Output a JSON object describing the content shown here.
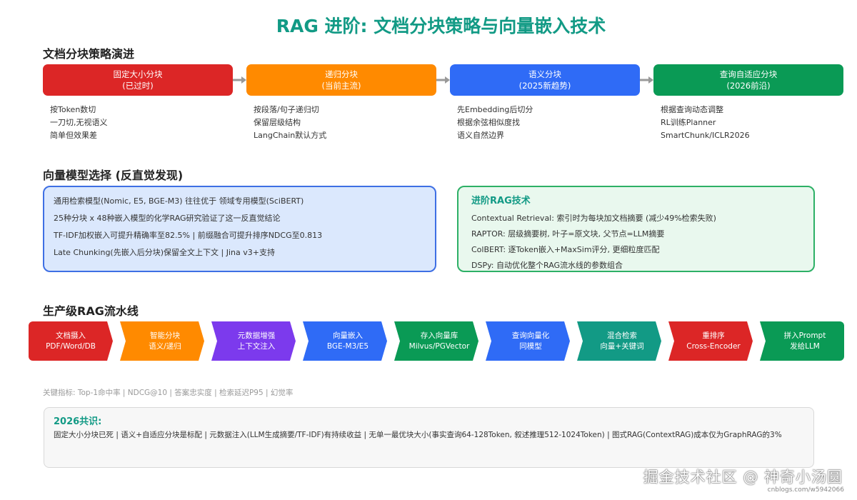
{
  "title": "RAG 进阶: 文档分块策略与向量嵌入技术",
  "section1": {
    "heading": "文档分块策略演进",
    "stages": [
      {
        "name": "固定大小分块",
        "sub": "(已过时)",
        "color": "#dc2626",
        "items": [
          "按Token数切",
          "一刀切,无视语义",
          "简单但效果差"
        ]
      },
      {
        "name": "递归分块",
        "sub": "(当前主流)",
        "color": "#ff8a00",
        "items": [
          "按段落/句子递归切",
          "保留层级结构",
          "LangChain默认方式"
        ]
      },
      {
        "name": "语义分块",
        "sub": "(2025新趋势)",
        "color": "#2f6bf6",
        "items": [
          "先Embedding后切分",
          "根据余弦相似度找",
          "语义自然边界"
        ]
      },
      {
        "name": "查询自适应分块",
        "sub": "(2026前沿)",
        "color": "#0a9a55",
        "items": [
          "根据查询动态调整",
          "RL训练Planner",
          "SmartChunk/ICLR2026"
        ]
      }
    ],
    "arrow_color": "#999999"
  },
  "section2": {
    "heading": "向量模型选择 (反直觉发现)",
    "left_lines": [
      "通用检索模型(Nomic, E5, BGE-M3) 往往优于 领域专用模型(SciBERT)",
      "25种分块 x 48种嵌入模型的化学RAG研究验证了这一反直觉结论",
      "TF-IDF加权嵌入可提升精确率至82.5% | 前缀融合可提升排序NDCG至0.813",
      "Late Chunking(先嵌入后分块)保留全文上下文 | Jina v3+支持"
    ],
    "right_title": "进阶RAG技术",
    "right_lines": [
      "Contextual Retrieval: 索引时为每块加文档摘要 (减少49%检索失败)",
      "RAPTOR: 层级摘要树, 叶子=原文块, 父节点=LLM摘要",
      "ColBERT: 逐Token嵌入+MaxSim评分, 更细粒度匹配",
      "DSPy: 自动优化整个RAG流水线的参数组合"
    ]
  },
  "section3": {
    "heading": "生产级RAG流水线",
    "steps": [
      {
        "l1": "文档摄入",
        "l2": "PDF/Word/DB",
        "color": "#dc2626"
      },
      {
        "l1": "智能分块",
        "l2": "语义/递归",
        "color": "#ff8a00"
      },
      {
        "l1": "元数据增强",
        "l2": "上下文注入",
        "color": "#7c3aed"
      },
      {
        "l1": "向量嵌入",
        "l2": "BGE-M3/E5",
        "color": "#2f6bf6"
      },
      {
        "l1": "存入向量库",
        "l2": "Milvus/PGVector",
        "color": "#0a9a55"
      },
      {
        "l1": "查询向量化",
        "l2": "同模型",
        "color": "#2f6bf6"
      },
      {
        "l1": "混合检索",
        "l2": "向量+关键词",
        "color": "#129a85"
      },
      {
        "l1": "重排序",
        "l2": "Cross-Encoder",
        "color": "#dc2626"
      },
      {
        "l1": "拼入Prompt",
        "l2": "发给LLM",
        "color": "#0a9a55"
      }
    ],
    "metrics": "关键指标: Top-1命中率 | NDCG@10 | 答案忠实度 | 检索延迟P95 | 幻觉率"
  },
  "consensus": {
    "title": "2026共识:",
    "text": "固定大小分块已死 | 语义+自适应分块是标配 | 元数据注入(LLM生成摘要/TF-IDF)有持续收益 | 无单一最优块大小(事实查询64-128Token, 叙述推理512-1024Token) | 图式RAG(ContextRAG)成本仅为GraphRAG的3%"
  },
  "watermark": {
    "text": "掘金技术社区 @ 神奇小汤圆",
    "url": "cnblogs.com/w5942066"
  }
}
